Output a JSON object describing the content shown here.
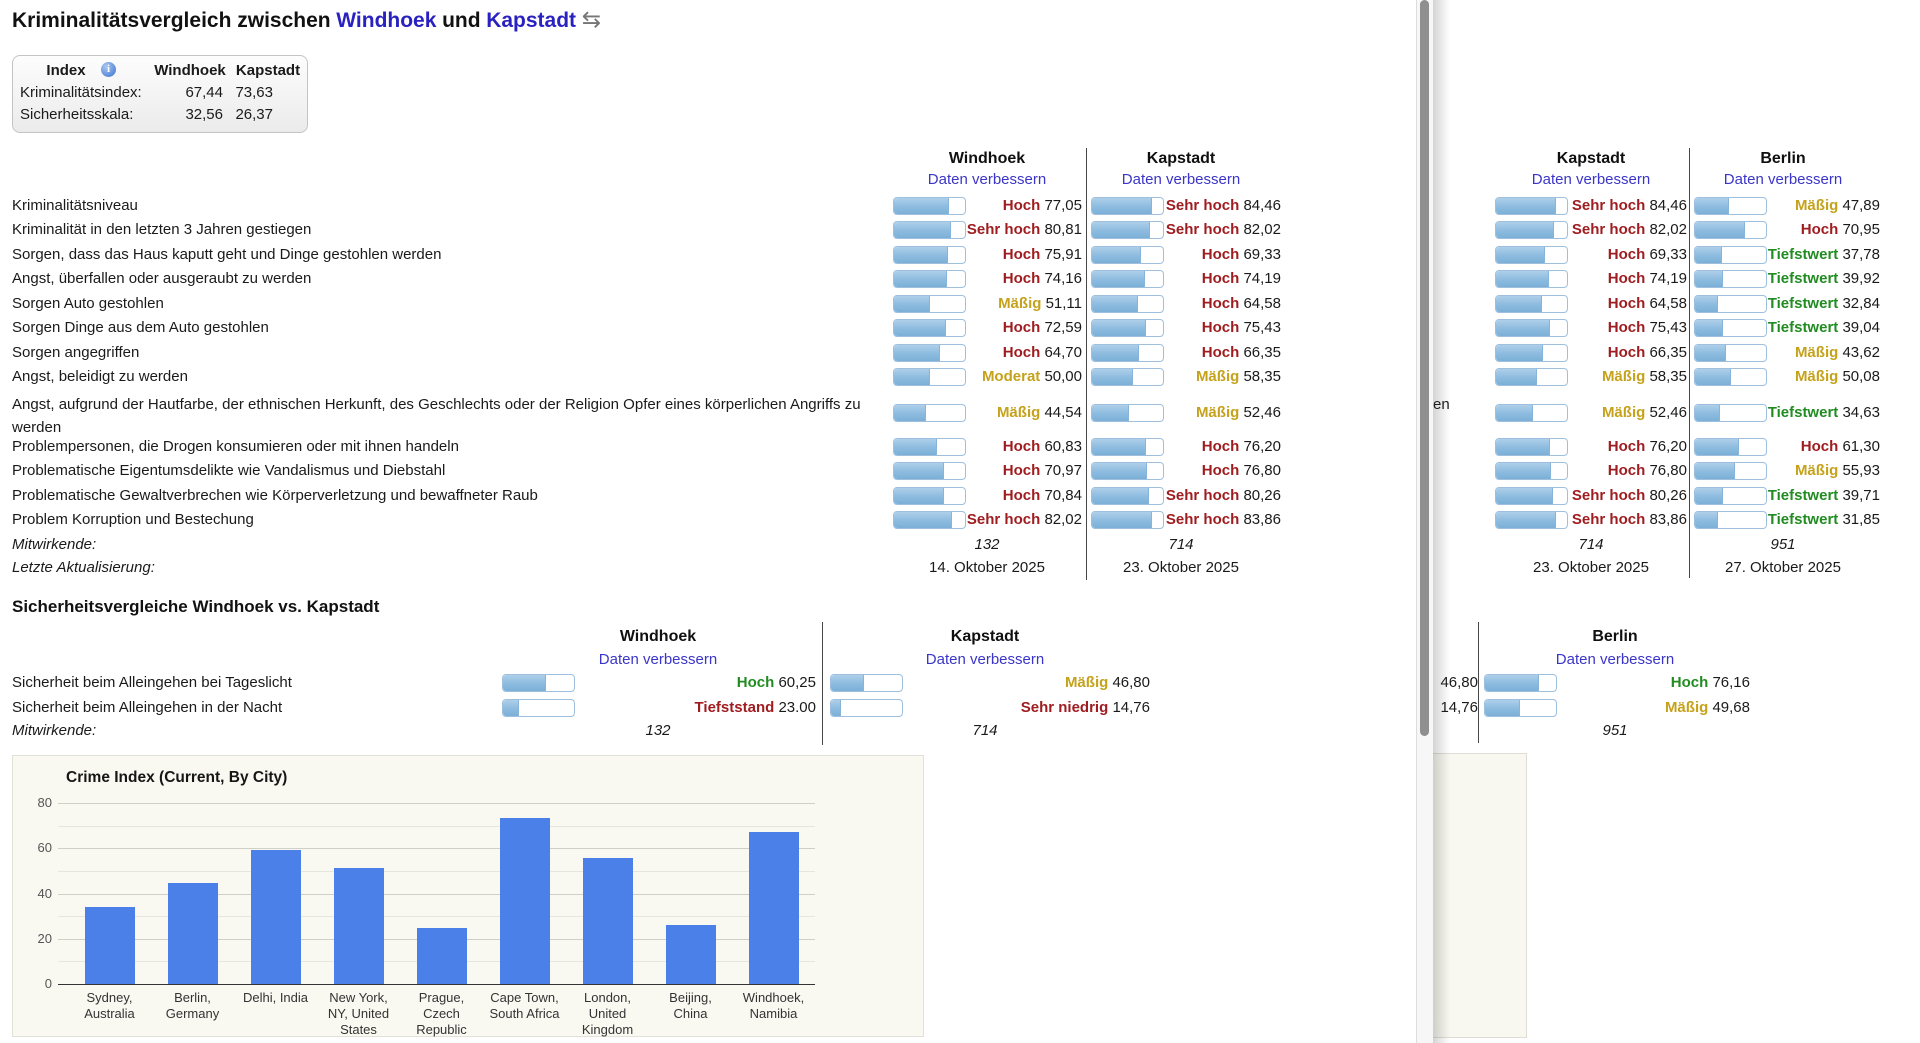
{
  "title": {
    "prefix": "Kriminalitätsvergleich zwischen",
    "city1": "Windhoek",
    "conj": "und",
    "city2": "Kapstadt",
    "swap_icon": "⇆"
  },
  "links": {
    "improve_data": "Daten verbessern"
  },
  "index_table": {
    "header": {
      "index": "Index",
      "city1": "Windhoek",
      "city2": "Kapstadt"
    },
    "rows": [
      {
        "label": "Kriminalitätsindex:",
        "city1": "67,44",
        "city2": "73,63"
      },
      {
        "label": "Sicherheitsskala:",
        "city1": "32,56",
        "city2": "26,37"
      }
    ]
  },
  "crime": {
    "row_labels": [
      "Kriminalitätsniveau",
      "Kriminalität in den letzten 3 Jahren gestiegen",
      "Sorgen, dass das Haus kaputt geht und Dinge gestohlen werden",
      "Angst, überfallen oder ausgeraubt zu werden",
      "Sorgen Auto gestohlen",
      "Sorgen Dinge aus dem Auto gestohlen",
      "Sorgen angegriffen",
      "Angst, beleidigt zu werden",
      "Angst, aufgrund der Hautfarbe, der ethnischen Herkunft, des Geschlechts oder der Religion Opfer eines körperlichen Angriffs zu werden",
      "Problempersonen, die Drogen konsumieren oder mit ihnen handeln",
      "Problematische Eigentumsdelikte wie Vandalismus und Diebstahl",
      "Problematische Gewaltverbrechen wie Körperverletzung und bewaffneter Raub",
      "Problem Korruption und Bestechung"
    ],
    "contributors_label": "Mitwirkende:",
    "updated_label": "Letzte Aktualisierung:",
    "left": {
      "col1": {
        "name": "Windhoek",
        "contributors": "132",
        "updated": "14. Oktober 2025",
        "cells": [
          {
            "rating": "Hoch",
            "value": "77,05",
            "pct": 77.05,
            "tone": "bad"
          },
          {
            "rating": "Sehr hoch",
            "value": "80,81",
            "pct": 80.81,
            "tone": "bad"
          },
          {
            "rating": "Hoch",
            "value": "75,91",
            "pct": 75.91,
            "tone": "bad"
          },
          {
            "rating": "Hoch",
            "value": "74,16",
            "pct": 74.16,
            "tone": "bad"
          },
          {
            "rating": "Mäßig",
            "value": "51,11",
            "pct": 51.11,
            "tone": "mid"
          },
          {
            "rating": "Hoch",
            "value": "72,59",
            "pct": 72.59,
            "tone": "bad"
          },
          {
            "rating": "Hoch",
            "value": "64,70",
            "pct": 64.7,
            "tone": "bad"
          },
          {
            "rating": "Moderat",
            "value": "50,00",
            "pct": 50.0,
            "tone": "mid"
          },
          {
            "rating": "Mäßig",
            "value": "44,54",
            "pct": 44.54,
            "tone": "mid"
          },
          {
            "rating": "Hoch",
            "value": "60,83",
            "pct": 60.83,
            "tone": "bad"
          },
          {
            "rating": "Hoch",
            "value": "70,97",
            "pct": 70.97,
            "tone": "bad"
          },
          {
            "rating": "Hoch",
            "value": "70,84",
            "pct": 70.84,
            "tone": "bad"
          },
          {
            "rating": "Sehr hoch",
            "value": "82,02",
            "pct": 82.02,
            "tone": "bad"
          }
        ]
      },
      "col2": {
        "name": "Kapstadt",
        "contributors": "714",
        "updated": "23. Oktober 2025",
        "cells": [
          {
            "rating": "Sehr hoch",
            "value": "84,46",
            "pct": 84.46,
            "tone": "bad"
          },
          {
            "rating": "Sehr hoch",
            "value": "82,02",
            "pct": 82.02,
            "tone": "bad"
          },
          {
            "rating": "Hoch",
            "value": "69,33",
            "pct": 69.33,
            "tone": "bad"
          },
          {
            "rating": "Hoch",
            "value": "74,19",
            "pct": 74.19,
            "tone": "bad"
          },
          {
            "rating": "Hoch",
            "value": "64,58",
            "pct": 64.58,
            "tone": "bad"
          },
          {
            "rating": "Hoch",
            "value": "75,43",
            "pct": 75.43,
            "tone": "bad"
          },
          {
            "rating": "Hoch",
            "value": "66,35",
            "pct": 66.35,
            "tone": "bad"
          },
          {
            "rating": "Mäßig",
            "value": "58,35",
            "pct": 58.35,
            "tone": "mid"
          },
          {
            "rating": "Mäßig",
            "value": "52,46",
            "pct": 52.46,
            "tone": "mid"
          },
          {
            "rating": "Hoch",
            "value": "76,20",
            "pct": 76.2,
            "tone": "bad"
          },
          {
            "rating": "Hoch",
            "value": "76,80",
            "pct": 76.8,
            "tone": "bad"
          },
          {
            "rating": "Sehr hoch",
            "value": "80,26",
            "pct": 80.26,
            "tone": "bad"
          },
          {
            "rating": "Sehr hoch",
            "value": "83,86",
            "pct": 83.86,
            "tone": "bad"
          }
        ]
      }
    },
    "right": {
      "label_fragment": "en",
      "col1": {
        "name": "Kapstadt",
        "contributors": "714",
        "updated": "23. Oktober 2025",
        "cells": [
          {
            "rating": "Sehr hoch",
            "value": "84,46",
            "pct": 84.46,
            "tone": "bad"
          },
          {
            "rating": "Sehr hoch",
            "value": "82,02",
            "pct": 82.02,
            "tone": "bad"
          },
          {
            "rating": "Hoch",
            "value": "69,33",
            "pct": 69.33,
            "tone": "bad"
          },
          {
            "rating": "Hoch",
            "value": "74,19",
            "pct": 74.19,
            "tone": "bad"
          },
          {
            "rating": "Hoch",
            "value": "64,58",
            "pct": 64.58,
            "tone": "bad"
          },
          {
            "rating": "Hoch",
            "value": "75,43",
            "pct": 75.43,
            "tone": "bad"
          },
          {
            "rating": "Hoch",
            "value": "66,35",
            "pct": 66.35,
            "tone": "bad"
          },
          {
            "rating": "Mäßig",
            "value": "58,35",
            "pct": 58.35,
            "tone": "mid"
          },
          {
            "rating": "Mäßig",
            "value": "52,46",
            "pct": 52.46,
            "tone": "mid"
          },
          {
            "rating": "Hoch",
            "value": "76,20",
            "pct": 76.2,
            "tone": "bad"
          },
          {
            "rating": "Hoch",
            "value": "76,80",
            "pct": 76.8,
            "tone": "bad"
          },
          {
            "rating": "Sehr hoch",
            "value": "80,26",
            "pct": 80.26,
            "tone": "bad"
          },
          {
            "rating": "Sehr hoch",
            "value": "83,86",
            "pct": 83.86,
            "tone": "bad"
          }
        ]
      },
      "col2": {
        "name": "Berlin",
        "contributors": "951",
        "updated": "27. Oktober 2025",
        "cells": [
          {
            "rating": "Mäßig",
            "value": "47,89",
            "pct": 47.89,
            "tone": "mid"
          },
          {
            "rating": "Hoch",
            "value": "70,95",
            "pct": 70.95,
            "tone": "bad"
          },
          {
            "rating": "Tiefstwert",
            "value": "37,78",
            "pct": 37.78,
            "tone": "good"
          },
          {
            "rating": "Tiefstwert",
            "value": "39,92",
            "pct": 39.92,
            "tone": "good"
          },
          {
            "rating": "Tiefstwert",
            "value": "32,84",
            "pct": 32.84,
            "tone": "good"
          },
          {
            "rating": "Tiefstwert",
            "value": "39,04",
            "pct": 39.04,
            "tone": "good"
          },
          {
            "rating": "Mäßig",
            "value": "43,62",
            "pct": 43.62,
            "tone": "mid"
          },
          {
            "rating": "Mäßig",
            "value": "50,08",
            "pct": 50.08,
            "tone": "mid"
          },
          {
            "rating": "Tiefstwert",
            "value": "34,63",
            "pct": 34.63,
            "tone": "good"
          },
          {
            "rating": "Hoch",
            "value": "61,30",
            "pct": 61.3,
            "tone": "bad"
          },
          {
            "rating": "Mäßig",
            "value": "55,93",
            "pct": 55.93,
            "tone": "mid"
          },
          {
            "rating": "Tiefstwert",
            "value": "39,71",
            "pct": 39.71,
            "tone": "good"
          },
          {
            "rating": "Tiefstwert",
            "value": "31,85",
            "pct": 31.85,
            "tone": "good"
          }
        ]
      }
    }
  },
  "safety": {
    "heading": "Sicherheitsvergleiche Windhoek vs. Kapstadt",
    "row_labels": [
      "Sicherheit beim Alleingehen bei Tageslicht",
      "Sicherheit beim Alleingehen in der Nacht"
    ],
    "contributors_label": "Mitwirkende:",
    "left": {
      "col1": {
        "name": "Windhoek",
        "contributors": "132",
        "cells": [
          {
            "rating": "Hoch",
            "value": "60,25",
            "pct": 60.25,
            "tone": "good"
          },
          {
            "rating": "Tiefststand",
            "value": "23.00",
            "pct": 23.0,
            "tone": "bad"
          }
        ]
      },
      "col2": {
        "name": "Kapstadt",
        "contributors": "714",
        "cells": [
          {
            "rating": "Mäßig",
            "value": "46,80",
            "pct": 46.8,
            "tone": "mid"
          },
          {
            "rating": "Sehr niedrig",
            "value": "14,76",
            "pct": 14.76,
            "tone": "bad"
          }
        ]
      }
    },
    "right": {
      "cut_values": [
        "46,80",
        "14,76"
      ],
      "col": {
        "name": "Berlin",
        "contributors": "951",
        "cells": [
          {
            "rating": "Hoch",
            "value": "76,16",
            "pct": 76.16,
            "tone": "good"
          },
          {
            "rating": "Mäßig",
            "value": "49,68",
            "pct": 49.68,
            "tone": "mid"
          }
        ]
      }
    }
  },
  "chart_data": {
    "type": "bar",
    "title": "Crime Index (Current, By City)",
    "categories": [
      "Sydney, Australia",
      "Berlin, Germany",
      "Delhi, India",
      "New York, NY, United States",
      "Prague, Czech Republic",
      "Cape Town, South Africa",
      "London, United Kingdom",
      "Beijing, China",
      "Windhoek, Namibia"
    ],
    "category_lines": [
      [
        "Sydney,",
        "Australia"
      ],
      [
        "Berlin,",
        "Germany"
      ],
      [
        "Delhi, India"
      ],
      [
        "New York,",
        "NY, United",
        "States"
      ],
      [
        "Prague,",
        "Czech",
        "Republic"
      ],
      [
        "Cape Town,",
        "South Africa"
      ],
      [
        "London,",
        "United",
        "Kingdom"
      ],
      [
        "Beijing,",
        "China"
      ],
      [
        "Windhoek,",
        "Namibia"
      ]
    ],
    "values": [
      34.2,
      44.6,
      59.2,
      51.5,
      24.6,
      73.63,
      55.6,
      25.9,
      67.44
    ],
    "xlabel": "",
    "ylabel": "",
    "ylim": [
      0,
      80
    ],
    "yticks": [
      0,
      20,
      40,
      60,
      80
    ],
    "grid": true,
    "legend": false,
    "bar_color": "#4a80e8"
  },
  "colors": {
    "bad": "#9f1d20",
    "mid": "#c5a21b",
    "good": "#218c21",
    "link": "#3b35c8",
    "city_link": "#2a22c0",
    "bar_fill": "#8cbbdf",
    "chart_bar": "#4a80e8"
  }
}
